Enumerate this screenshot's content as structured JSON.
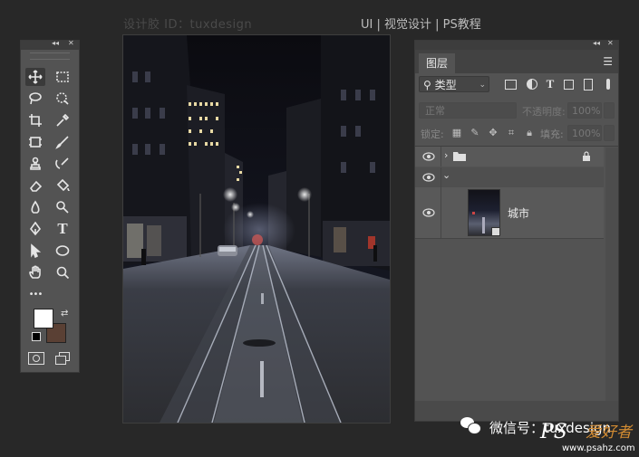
{
  "header": {
    "watermark_left": "设计胶 ID：tuxdesign",
    "watermark_right": "UI | 视觉设计 | PS教程"
  },
  "toolbar": {
    "collapse": "◂◂",
    "close": "✕",
    "tools": [
      "move-tool",
      "marquee-tool",
      "lasso-tool",
      "quick-select-tool",
      "crop-tool",
      "eyedropper-tool",
      "frame-tool",
      "brush-tool",
      "stamp-tool",
      "history-brush-tool",
      "eraser-tool",
      "bucket-tool",
      "blur-tool",
      "dodge-tool",
      "pen-tool",
      "type-tool",
      "path-select-tool",
      "ellipse-tool",
      "hand-tool",
      "zoom-tool",
      "more-tools"
    ],
    "type_glyph": "T",
    "more_glyph": "•••",
    "foreground_color": "#ffffff",
    "background_color": "#5a4034"
  },
  "layers_panel": {
    "collapse": "◂◂",
    "close": "✕",
    "tab_label": "图层",
    "menu_glyph": "☰",
    "kind_label": "类型",
    "kind_search_glyph": "⚲",
    "kind_dropdown_glyph": "⌄",
    "filter_T": "T",
    "blend_mode": "正常",
    "opacity_label": "不透明度:",
    "opacity_value": "100%",
    "lock_label": "锁定:",
    "fill_label": "填充:",
    "fill_value": "100%",
    "layers": [
      {
        "name": "",
        "type": "group",
        "locked": true
      },
      {
        "name": "",
        "type": "group-open"
      },
      {
        "name": "城市",
        "type": "smart-object"
      }
    ]
  },
  "watermark": {
    "wechat": "微信号：tuxdesign",
    "ps": "PS",
    "site_cn": "爱好者",
    "url": "www.psahz.com"
  }
}
